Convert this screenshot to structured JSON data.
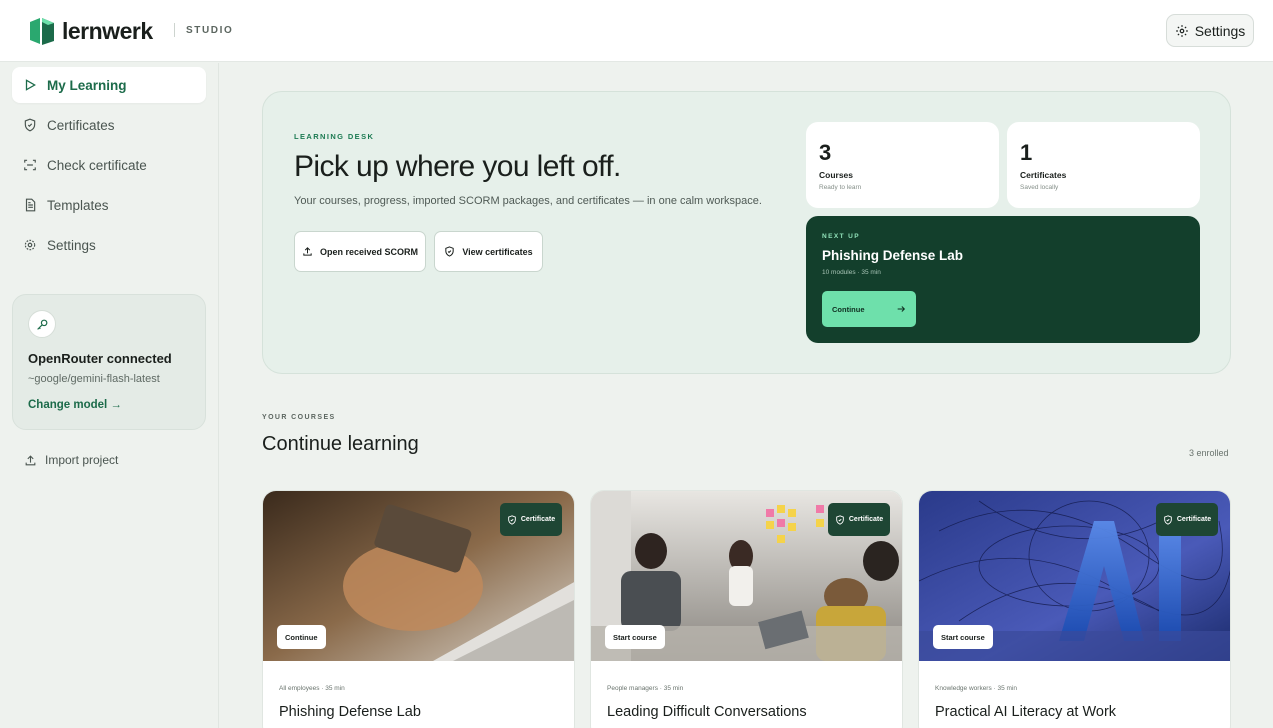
{
  "app": {
    "name": "lernwerk",
    "studio": "STUDIO",
    "settings_label": "Settings",
    "brand_color": "#1c6b4a"
  },
  "sidebar": {
    "items": [
      {
        "label": "My Learning",
        "icon": "play-icon",
        "active": true
      },
      {
        "label": "Certificates",
        "icon": "shield-check-icon",
        "active": false
      },
      {
        "label": "Check certificate",
        "icon": "scan-icon",
        "active": false
      },
      {
        "label": "Templates",
        "icon": "document-icon",
        "active": false
      },
      {
        "label": "Settings",
        "icon": "gear-icon",
        "active": false
      }
    ],
    "openrouter": {
      "icon": "key-icon",
      "title": "OpenRouter connected",
      "model": "~google/gemini-flash-latest",
      "change_label": "Change model →"
    },
    "import_label": "Import project"
  },
  "hero": {
    "eyebrow": "LEARNING DESK",
    "title": "Pick up where you left off.",
    "subtitle": "Your courses, progress, imported SCORM packages, and certificates — in one calm workspace.",
    "buttons": {
      "open_scorm": "Open received SCORM",
      "view_certs": "View certificates"
    },
    "stats": [
      {
        "value": "3",
        "label": "Courses",
        "sub": "Ready to learn"
      },
      {
        "value": "1",
        "label": "Certificates",
        "sub": "Saved locally"
      }
    ],
    "next_up": {
      "eyebrow": "NEXT UP",
      "title": "Phishing Defense Lab",
      "meta": "10 modules · 35 min",
      "button": "Continue"
    }
  },
  "courses": {
    "eyebrow": "YOUR COURSES",
    "title": "Continue learning",
    "count": "3 enrolled",
    "items": [
      {
        "badge": "Certificate",
        "button": "Continue",
        "meta": "All employees · 35 min",
        "title": "Phishing Defense Lab"
      },
      {
        "badge": "Certificate",
        "button": "Start course",
        "meta": "People managers · 35 min",
        "title": "Leading Difficult Conversations"
      },
      {
        "badge": "Certificate",
        "button": "Start course",
        "meta": "Knowledge workers · 35 min",
        "title": "Practical AI Literacy at Work"
      }
    ]
  }
}
